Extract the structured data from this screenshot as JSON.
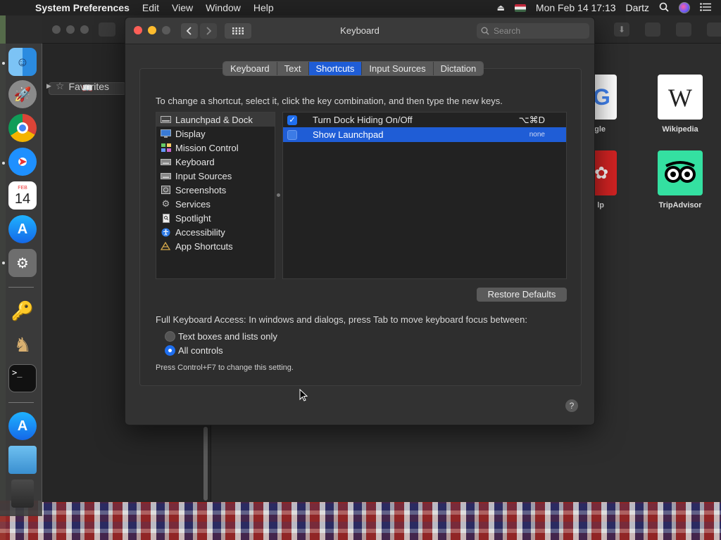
{
  "menubar": {
    "app_name": "System Preferences",
    "items": [
      "Edit",
      "View",
      "Window",
      "Help"
    ],
    "clock": "Mon Feb 14  17:13",
    "user": "Dartz"
  },
  "dock": {
    "icons": [
      "finder-icon",
      "launchpad-icon",
      "chrome-icon",
      "safari-icon",
      "calendar-icon",
      "app-store-icon",
      "system-preferences-icon",
      "keychain-icon",
      "chess-icon",
      "terminal-icon",
      "app-store-downloads-icon",
      "folder-icon",
      "trash-icon"
    ],
    "calendar_month": "FEB",
    "calendar_day": "14"
  },
  "safari": {
    "sidebar_favorites": "Favorites",
    "tiles": [
      {
        "label": "gle"
      },
      {
        "label": "Wikipedia"
      },
      {
        "label": "lp"
      },
      {
        "label": "TripAdvisor"
      }
    ]
  },
  "window": {
    "title": "Keyboard",
    "search_placeholder": "Search",
    "tabs": [
      {
        "label": "Keyboard",
        "active": false
      },
      {
        "label": "Text",
        "active": false
      },
      {
        "label": "Shortcuts",
        "active": true
      },
      {
        "label": "Input Sources",
        "active": false
      },
      {
        "label": "Dictation",
        "active": false
      }
    ],
    "instruction": "To change a shortcut, select it, click the key combination, and then type the new keys.",
    "categories": [
      {
        "label": "Launchpad & Dock",
        "icon": "launchpad-dock-icon",
        "selected": true
      },
      {
        "label": "Display",
        "icon": "display-icon",
        "selected": false
      },
      {
        "label": "Mission Control",
        "icon": "mission-control-icon",
        "selected": false
      },
      {
        "label": "Keyboard",
        "icon": "keyboard-icon",
        "selected": false
      },
      {
        "label": "Input Sources",
        "icon": "input-sources-icon",
        "selected": false
      },
      {
        "label": "Screenshots",
        "icon": "screenshots-icon",
        "selected": false
      },
      {
        "label": "Services",
        "icon": "gear-icon",
        "selected": false
      },
      {
        "label": "Spotlight",
        "icon": "spotlight-icon",
        "selected": false
      },
      {
        "label": "Accessibility",
        "icon": "accessibility-icon",
        "selected": false
      },
      {
        "label": "App Shortcuts",
        "icon": "app-shortcuts-icon",
        "selected": false
      }
    ],
    "shortcuts": [
      {
        "label": "Turn Dock Hiding On/Off",
        "key": "⌥⌘D",
        "checked": true,
        "selected": false
      },
      {
        "label": "Show Launchpad",
        "key": "none",
        "checked": false,
        "selected": true
      }
    ],
    "restore_defaults": "Restore Defaults",
    "full_keyboard_access": "Full Keyboard Access: In windows and dialogs, press Tab to move keyboard focus between:",
    "radio_options": [
      {
        "label": "Text boxes and lists only",
        "selected": false
      },
      {
        "label": "All controls",
        "selected": true
      }
    ],
    "hint": "Press Control+F7 to change this setting.",
    "help_label": "?"
  },
  "colors": {
    "accent": "#1f5dd6",
    "window_bg": "#323232",
    "close": "#fe5f57",
    "minimize": "#febc2e",
    "zoom_disabled": "#5a5a5a"
  }
}
